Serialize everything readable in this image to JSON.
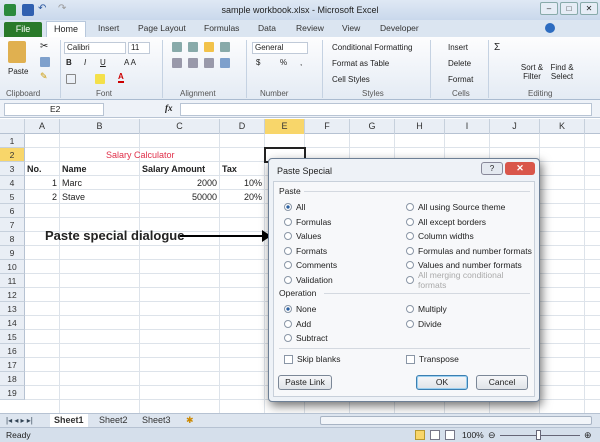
{
  "window": {
    "title": "sample workbook.xlsx - Microsoft Excel",
    "buttons": [
      "minimize",
      "maximize",
      "close"
    ]
  },
  "ribbon_tabs": [
    "File",
    "Home",
    "Insert",
    "Page Layout",
    "Formulas",
    "Data",
    "Review",
    "View",
    "Developer"
  ],
  "ribbon": {
    "clipboard": {
      "label": "Clipboard",
      "paste": "Paste"
    },
    "font": {
      "label": "Font",
      "name": "Calibri",
      "size": "11"
    },
    "alignment": {
      "label": "Alignment"
    },
    "number": {
      "label": "Number",
      "format": "General",
      "currency": "$",
      "percent": "%",
      "comma": ","
    },
    "styles": {
      "label": "Styles",
      "items": [
        "Conditional Formatting",
        "Format as Table",
        "Cell Styles"
      ]
    },
    "cells": {
      "label": "Cells",
      "items": [
        "Insert",
        "Delete",
        "Format"
      ]
    },
    "editing": {
      "label": "Editing",
      "sort": "Sort &",
      "sort2": "Filter",
      "find": "Find &",
      "find2": "Select",
      "sum": "Σ"
    }
  },
  "formula_bar": {
    "name_box": "E2",
    "fx": "fx",
    "value": ""
  },
  "columns": [
    "A",
    "B",
    "C",
    "D",
    "E",
    "F",
    "G",
    "H",
    "I",
    "J",
    "K"
  ],
  "selected_column": "E",
  "rows": [
    "1",
    "2",
    "3",
    "4",
    "5",
    "6",
    "7",
    "8",
    "9",
    "10",
    "11",
    "12",
    "13",
    "14",
    "15",
    "16",
    "17",
    "18",
    "19"
  ],
  "selected_row": "2",
  "cells": {
    "B2": "Salary Calculator",
    "A3": "No.",
    "B3": "Name",
    "C3": "Salary Amount",
    "D3": "Tax",
    "A4": "1",
    "B4": "Marc",
    "C4": "2000",
    "D4": "10%",
    "A5": "2",
    "B5": "Stave",
    "C5": "50000",
    "D5": "20%"
  },
  "colors": {
    "title_red": "#e0304a",
    "accent_selection": "#f8d66a",
    "file_tab": "#2a7a2a"
  },
  "annotation": "Paste special dialogue",
  "dialog": {
    "title": "Paste Special",
    "help": "?",
    "close": "✕",
    "paste_label": "Paste",
    "paste_left": [
      "All",
      "Formulas",
      "Values",
      "Formats",
      "Comments",
      "Validation"
    ],
    "paste_right": [
      "All using Source theme",
      "All except borders",
      "Column widths",
      "Formulas and number formats",
      "Values and number formats",
      "All merging conditional formats"
    ],
    "paste_selected": "All",
    "operation_label": "Operation",
    "operation_left": [
      "None",
      "Add",
      "Subtract"
    ],
    "operation_right": [
      "Multiply",
      "Divide"
    ],
    "operation_selected": "None",
    "skip_blanks": "Skip blanks",
    "transpose": "Transpose",
    "paste_link": "Paste Link",
    "ok": "OK",
    "cancel": "Cancel"
  },
  "sheets": [
    "Sheet1",
    "Sheet2",
    "Sheet3"
  ],
  "active_sheet": "Sheet1",
  "status": {
    "text": "Ready",
    "zoom": "100%"
  }
}
